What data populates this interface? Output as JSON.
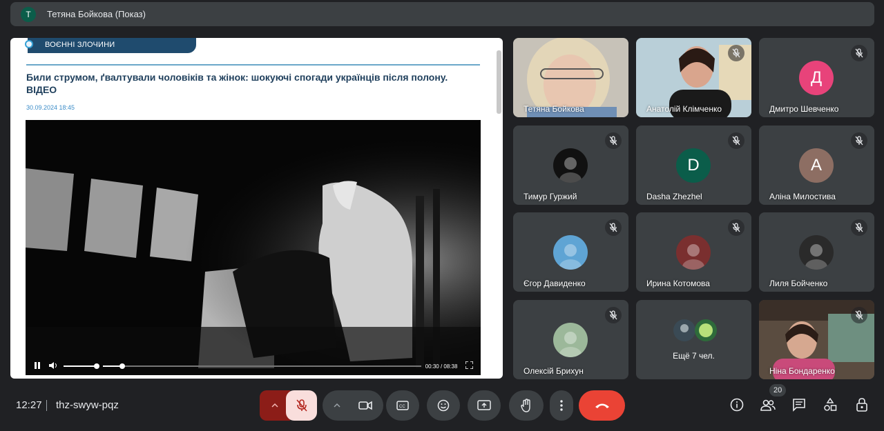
{
  "presenter_bar": {
    "avatar_letter": "T",
    "title": "Тетяна Бойкова (Показ)"
  },
  "article": {
    "category": "ВОЄННІ ЗЛОЧИНИ",
    "headline": "Били струмом, ґвалтували чоловіків та жінок: шокуючі спогади українців після полону. ВІДЕО",
    "date": "30.09.2024 18:45",
    "video": {
      "time": "00:30 / 08:38",
      "progress": 0.06
    }
  },
  "participants": [
    {
      "name": "Тетяна Бойкова",
      "kind": "video",
      "muted": false
    },
    {
      "name": "Анатолій Клімченко",
      "kind": "video",
      "muted": true
    },
    {
      "name": "Дмитро Шевченко",
      "kind": "letter",
      "letter": "Д",
      "color": "#e8437a",
      "muted": true
    },
    {
      "name": "Тимур Гуржий",
      "kind": "photo",
      "color": "#111111",
      "muted": true
    },
    {
      "name": "Dasha Zhezhel",
      "kind": "letter",
      "letter": "D",
      "color": "#0b5d4a",
      "muted": true
    },
    {
      "name": "Аліна Милостива",
      "kind": "letter",
      "letter": "А",
      "color": "#8d6e63",
      "muted": true
    },
    {
      "name": "Єгор Давиденко",
      "kind": "photo",
      "color": "#5fa4d4",
      "muted": true
    },
    {
      "name": "Ирина Котомова",
      "kind": "photo",
      "color": "#7a2f2f",
      "muted": true
    },
    {
      "name": "Лиля Бойченко",
      "kind": "photo",
      "color": "#2a2a2a",
      "muted": true
    },
    {
      "name": "Олексій Брихун",
      "kind": "photo",
      "color": "#9cb89a",
      "muted": true
    },
    {
      "name": "",
      "kind": "more",
      "label": "Ещё 7 чел."
    },
    {
      "name": "Ніна Бондаренко",
      "kind": "video",
      "muted": true
    }
  ],
  "bottom_bar": {
    "time": "12:27",
    "meeting_code": "thz-swyw-pqz",
    "participants_count": "20"
  },
  "colors": {
    "end_call": "#ea4335",
    "mic_off_bg": "#f9dedc",
    "mic_off_icon": "#b3261e"
  }
}
